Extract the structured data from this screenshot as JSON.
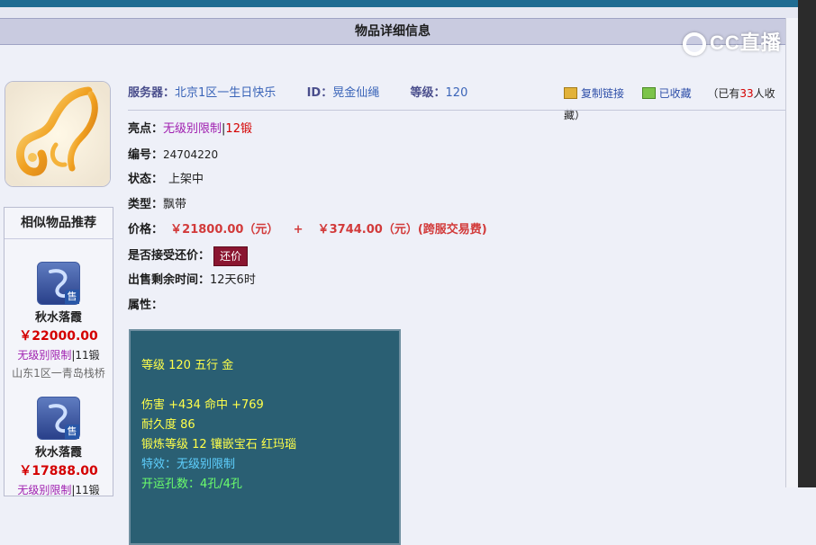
{
  "titlebar": {
    "title": "物品详细信息"
  },
  "watermark": {
    "text": "CC直播"
  },
  "info": {
    "server_label": "服务器：",
    "server": "北京1区一生日快乐",
    "id_label": "ID：",
    "id": "晃金仙绳",
    "level_label": "等级：",
    "level": "120",
    "copy_link": "复制链接",
    "favorited": "已收藏",
    "fav_prefix": "（已有",
    "fav_count": "33",
    "fav_suffix": "人收藏）"
  },
  "details": {
    "highlight_label": "亮点：",
    "highlight_a": "无级别限制",
    "highlight_sep": "|",
    "highlight_b": "12锻",
    "number_label": "编号：",
    "number": "24704220",
    "status_label": "状态：",
    "status": "上架中",
    "type_label": "类型：",
    "type": "飘带",
    "price_label": "价格：",
    "price": "￥21800.00（元）",
    "plus": "+",
    "fee": "￥3744.00（元）(跨服交易费)",
    "counter_label": "是否接受还价：",
    "counter_button": "还价",
    "time_label": "出售剩余时间：",
    "time": "12天6时",
    "attr_label": "属性："
  },
  "attributes": {
    "line1": "等级 120 五行 金",
    "line2": "伤害 +434 命中 +769",
    "line3": "耐久度 86",
    "line4": "锻炼等级 12 镶嵌宝石 红玛瑙",
    "line5": "特效：无级别限制",
    "line6": "开运孔数：4孔/4孔"
  },
  "sidebar": {
    "title": "相似物品推荐",
    "sell_badge": "售",
    "items": [
      {
        "name": "秋水落霞",
        "price": "￥22000.00",
        "tag_a": "无级别限制",
        "tag_sep": "|",
        "tag_b": "11锻",
        "server": "山东1区一青岛栈桥"
      },
      {
        "name": "秋水落霞",
        "price": "￥17888.00",
        "tag_a": "无级别限制",
        "tag_sep": "|",
        "tag_b": "11锻",
        "server": ""
      }
    ]
  }
}
